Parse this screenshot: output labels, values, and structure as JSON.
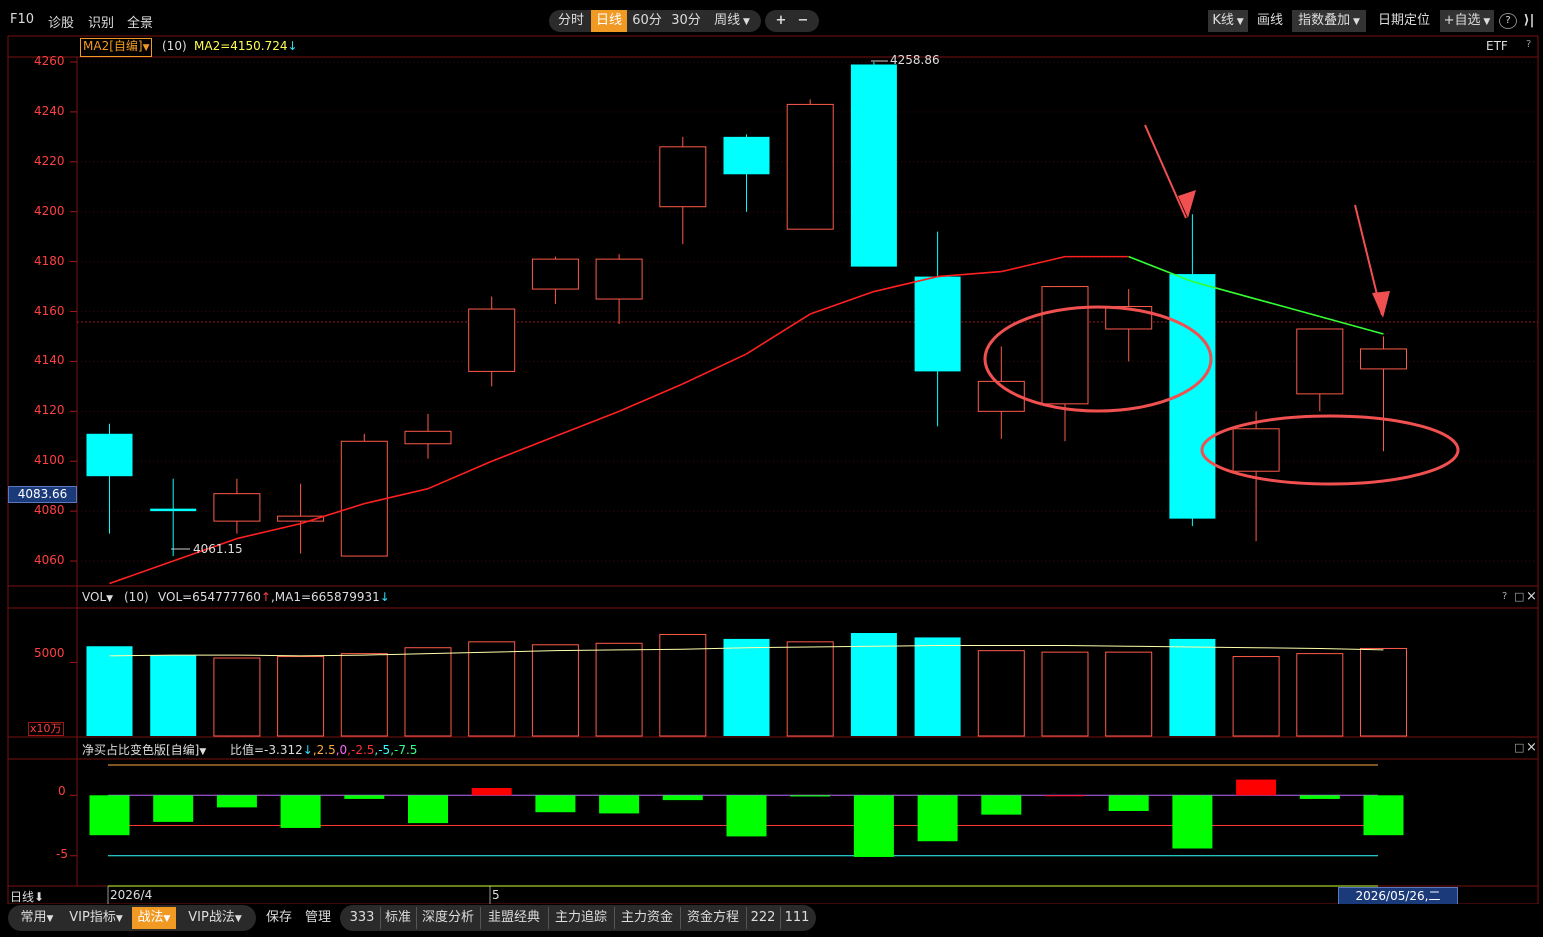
{
  "topbar": {
    "left": [
      "F10",
      "诊股",
      "识别",
      "全景"
    ],
    "periods": [
      {
        "label": "分时",
        "active": false
      },
      {
        "label": "日线",
        "active": true
      },
      {
        "label": "60分",
        "active": false
      },
      {
        "label": "30分",
        "active": false
      },
      {
        "label": "周线",
        "active": false,
        "dropdown": true
      }
    ],
    "zoom": [
      "+",
      "−"
    ],
    "right": [
      "K线",
      "画线",
      "指数叠加",
      "日期定位",
      "+自选"
    ],
    "right_icons": [
      "?",
      "⟩|"
    ],
    "etf_label": "ETF",
    "help": "?"
  },
  "main_panel": {
    "indicator_name": "MA2[自编]",
    "indicator_param": "(10)",
    "indicator_value": "MA2=4150.724",
    "current_price_label": "4083.66",
    "y_ticks": [
      "4260",
      "4240",
      "4220",
      "4200",
      "4180",
      "4160",
      "4140",
      "4120",
      "4100",
      "4080",
      "4060"
    ],
    "high_label": "4258.86",
    "low_label": "4061.15"
  },
  "vol_panel": {
    "name": "VOL",
    "param": "(10)",
    "vol_value": "VOL=654777760",
    "ma_value": ",MA1=665879931",
    "y_tick": "5000",
    "unit": "x10万",
    "icons": [
      "?",
      "□",
      "×"
    ]
  },
  "ratio_panel": {
    "title": "净买占比变色版[自编]",
    "value_label": "比值=-3.312",
    "levels": [
      ",2.5",
      ",0",
      ",-2.5",
      ",-5",
      ",-7.5"
    ],
    "y_ticks": [
      "0",
      "-5"
    ],
    "icons": [
      "□",
      "×"
    ]
  },
  "xaxis": {
    "period_label": "日线",
    "labels": [
      "2026/4",
      "5"
    ],
    "cursor_date": "2026/05/26,二"
  },
  "bottombar": {
    "items": [
      "常用",
      "VIP指标",
      "战法",
      "VIP战法",
      "保存",
      "管理",
      "333",
      "标准",
      "深度分析",
      "韭盟经典",
      "主力追踪",
      "主力资金",
      "资金方程",
      "222",
      "111"
    ]
  },
  "colors": {
    "up": "#ff5a4a",
    "down": "#00ffff",
    "ma_up": "#ff2020",
    "ma_down": "#33ff33",
    "ratio_pos": "#ff0000",
    "ratio_neg": "#00ff00",
    "accent": "#f09a24"
  },
  "chart_data": {
    "type": "candlestick",
    "ylim": [
      4050,
      4262
    ],
    "candles": [
      {
        "o": 4111,
        "h": 4115,
        "l": 4071,
        "c": 4094
      },
      {
        "o": 4081,
        "h": 4093,
        "l": 4062,
        "c": 4080
      },
      {
        "o": 4076,
        "h": 4093,
        "l": 4071,
        "c": 4087
      },
      {
        "o": 4076,
        "h": 4091,
        "l": 4063,
        "c": 4078
      },
      {
        "o": 4062,
        "h": 4111,
        "l": 4062,
        "c": 4108
      },
      {
        "o": 4107,
        "h": 4119,
        "l": 4101,
        "c": 4112
      },
      {
        "o": 4136,
        "h": 4166,
        "l": 4130,
        "c": 4161
      },
      {
        "o": 4169,
        "h": 4182,
        "l": 4163,
        "c": 4181
      },
      {
        "o": 4165,
        "h": 4183,
        "l": 4155,
        "c": 4181
      },
      {
        "o": 4202,
        "h": 4230,
        "l": 4187,
        "c": 4226
      },
      {
        "o": 4230,
        "h": 4231,
        "l": 4200,
        "c": 4215
      },
      {
        "o": 4193,
        "h": 4245,
        "l": 4193,
        "c": 4243
      },
      {
        "o": 4259,
        "h": 4260,
        "l": 4178,
        "c": 4178
      },
      {
        "o": 4174,
        "h": 4192,
        "l": 4114,
        "c": 4136
      },
      {
        "o": 4120,
        "h": 4146,
        "l": 4109,
        "c": 4132
      },
      {
        "o": 4123,
        "h": 4170,
        "l": 4108,
        "c": 4170
      },
      {
        "o": 4153,
        "h": 4169,
        "l": 4140,
        "c": 4162
      },
      {
        "o": 4175,
        "h": 4199,
        "l": 4074,
        "c": 4077
      },
      {
        "o": 4096,
        "h": 4120,
        "l": 4068,
        "c": 4113
      },
      {
        "o": 4127,
        "h": 4153,
        "l": 4120,
        "c": 4153
      },
      {
        "o": 4137,
        "h": 4150,
        "l": 4104,
        "c": 4145
      }
    ],
    "ma": [
      4051,
      4060,
      4069,
      4075,
      4083,
      4089,
      4100,
      4110,
      4120,
      4131,
      4143,
      4159,
      4168,
      4174,
      4176,
      4182,
      4182,
      4172,
      4165,
      4158,
      4151
    ],
    "ma_down_from": 16,
    "volume": {
      "ylim": [
        0,
        8700
      ],
      "values": [
        6100,
        5500,
        5300,
        5400,
        5600,
        6000,
        6400,
        6200,
        6300,
        6900,
        6600,
        6400,
        7000,
        6700,
        5800,
        5700,
        5700,
        6600,
        5400,
        5600,
        5950
      ],
      "ma": [
        5450,
        5500,
        5500,
        5450,
        5500,
        5600,
        5700,
        5800,
        5850,
        5900,
        6000,
        6050,
        6100,
        6150,
        6150,
        6150,
        6100,
        6050,
        6000,
        5950,
        5850
      ]
    },
    "ratio": {
      "ylim": [
        -7.5,
        3
      ],
      "values": [
        -3.3,
        -2.2,
        -1.0,
        -2.7,
        -0.3,
        -2.3,
        0.6,
        -1.4,
        -1.5,
        -0.4,
        -3.4,
        -0.1,
        -5.1,
        -3.8,
        -1.6,
        0,
        -1.3,
        -4.4,
        1.3,
        -0.3,
        -3.3
      ],
      "levels": [
        2.5,
        0,
        -2.5,
        -5,
        -7.5
      ]
    },
    "annotations": [
      "arrow",
      "arrow",
      "ellipse",
      "ellipse"
    ]
  }
}
